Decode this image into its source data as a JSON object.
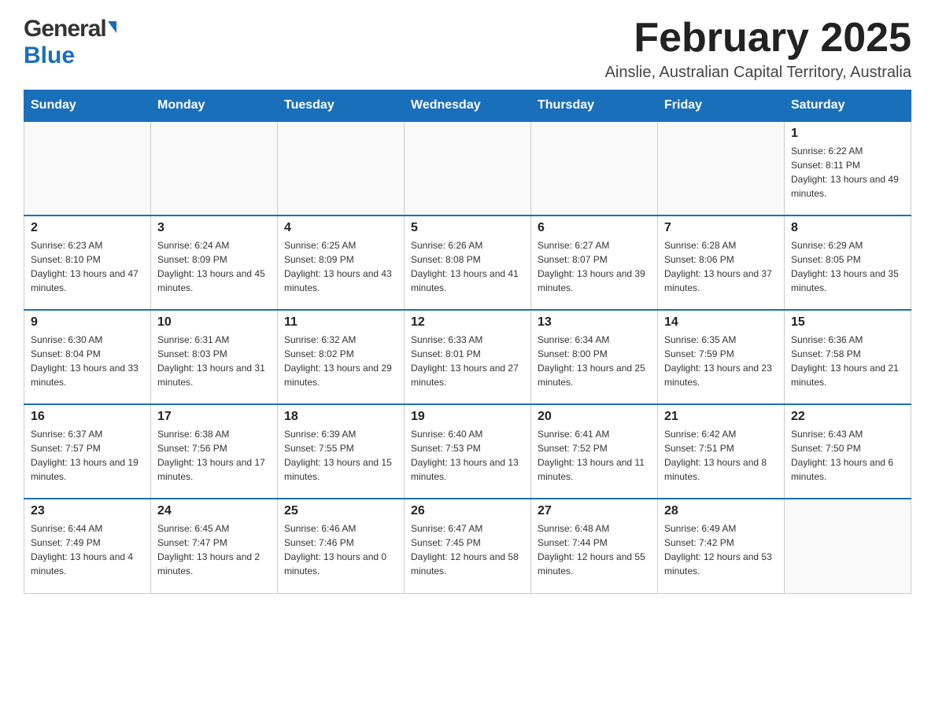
{
  "header": {
    "logo_general": "General",
    "logo_blue": "Blue",
    "month_title": "February 2025",
    "subtitle": "Ainslie, Australian Capital Territory, Australia"
  },
  "days_of_week": [
    "Sunday",
    "Monday",
    "Tuesday",
    "Wednesday",
    "Thursday",
    "Friday",
    "Saturday"
  ],
  "weeks": [
    [
      {
        "day": "",
        "info": ""
      },
      {
        "day": "",
        "info": ""
      },
      {
        "day": "",
        "info": ""
      },
      {
        "day": "",
        "info": ""
      },
      {
        "day": "",
        "info": ""
      },
      {
        "day": "",
        "info": ""
      },
      {
        "day": "1",
        "info": "Sunrise: 6:22 AM\nSunset: 8:11 PM\nDaylight: 13 hours and 49 minutes."
      }
    ],
    [
      {
        "day": "2",
        "info": "Sunrise: 6:23 AM\nSunset: 8:10 PM\nDaylight: 13 hours and 47 minutes."
      },
      {
        "day": "3",
        "info": "Sunrise: 6:24 AM\nSunset: 8:09 PM\nDaylight: 13 hours and 45 minutes."
      },
      {
        "day": "4",
        "info": "Sunrise: 6:25 AM\nSunset: 8:09 PM\nDaylight: 13 hours and 43 minutes."
      },
      {
        "day": "5",
        "info": "Sunrise: 6:26 AM\nSunset: 8:08 PM\nDaylight: 13 hours and 41 minutes."
      },
      {
        "day": "6",
        "info": "Sunrise: 6:27 AM\nSunset: 8:07 PM\nDaylight: 13 hours and 39 minutes."
      },
      {
        "day": "7",
        "info": "Sunrise: 6:28 AM\nSunset: 8:06 PM\nDaylight: 13 hours and 37 minutes."
      },
      {
        "day": "8",
        "info": "Sunrise: 6:29 AM\nSunset: 8:05 PM\nDaylight: 13 hours and 35 minutes."
      }
    ],
    [
      {
        "day": "9",
        "info": "Sunrise: 6:30 AM\nSunset: 8:04 PM\nDaylight: 13 hours and 33 minutes."
      },
      {
        "day": "10",
        "info": "Sunrise: 6:31 AM\nSunset: 8:03 PM\nDaylight: 13 hours and 31 minutes."
      },
      {
        "day": "11",
        "info": "Sunrise: 6:32 AM\nSunset: 8:02 PM\nDaylight: 13 hours and 29 minutes."
      },
      {
        "day": "12",
        "info": "Sunrise: 6:33 AM\nSunset: 8:01 PM\nDaylight: 13 hours and 27 minutes."
      },
      {
        "day": "13",
        "info": "Sunrise: 6:34 AM\nSunset: 8:00 PM\nDaylight: 13 hours and 25 minutes."
      },
      {
        "day": "14",
        "info": "Sunrise: 6:35 AM\nSunset: 7:59 PM\nDaylight: 13 hours and 23 minutes."
      },
      {
        "day": "15",
        "info": "Sunrise: 6:36 AM\nSunset: 7:58 PM\nDaylight: 13 hours and 21 minutes."
      }
    ],
    [
      {
        "day": "16",
        "info": "Sunrise: 6:37 AM\nSunset: 7:57 PM\nDaylight: 13 hours and 19 minutes."
      },
      {
        "day": "17",
        "info": "Sunrise: 6:38 AM\nSunset: 7:56 PM\nDaylight: 13 hours and 17 minutes."
      },
      {
        "day": "18",
        "info": "Sunrise: 6:39 AM\nSunset: 7:55 PM\nDaylight: 13 hours and 15 minutes."
      },
      {
        "day": "19",
        "info": "Sunrise: 6:40 AM\nSunset: 7:53 PM\nDaylight: 13 hours and 13 minutes."
      },
      {
        "day": "20",
        "info": "Sunrise: 6:41 AM\nSunset: 7:52 PM\nDaylight: 13 hours and 11 minutes."
      },
      {
        "day": "21",
        "info": "Sunrise: 6:42 AM\nSunset: 7:51 PM\nDaylight: 13 hours and 8 minutes."
      },
      {
        "day": "22",
        "info": "Sunrise: 6:43 AM\nSunset: 7:50 PM\nDaylight: 13 hours and 6 minutes."
      }
    ],
    [
      {
        "day": "23",
        "info": "Sunrise: 6:44 AM\nSunset: 7:49 PM\nDaylight: 13 hours and 4 minutes."
      },
      {
        "day": "24",
        "info": "Sunrise: 6:45 AM\nSunset: 7:47 PM\nDaylight: 13 hours and 2 minutes."
      },
      {
        "day": "25",
        "info": "Sunrise: 6:46 AM\nSunset: 7:46 PM\nDaylight: 13 hours and 0 minutes."
      },
      {
        "day": "26",
        "info": "Sunrise: 6:47 AM\nSunset: 7:45 PM\nDaylight: 12 hours and 58 minutes."
      },
      {
        "day": "27",
        "info": "Sunrise: 6:48 AM\nSunset: 7:44 PM\nDaylight: 12 hours and 55 minutes."
      },
      {
        "day": "28",
        "info": "Sunrise: 6:49 AM\nSunset: 7:42 PM\nDaylight: 12 hours and 53 minutes."
      },
      {
        "day": "",
        "info": ""
      }
    ]
  ]
}
